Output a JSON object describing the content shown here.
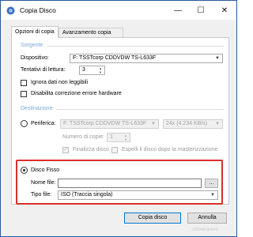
{
  "window": {
    "title": "Copia Disco",
    "minimize_glyph": "—",
    "maximize_glyph": "☐",
    "close_glyph": "✕"
  },
  "tabs": [
    {
      "label": "Opzioni di copia"
    },
    {
      "label": "Avanzamento copia"
    }
  ],
  "source": {
    "group_title": "Sorgente",
    "device_label": "Dispositivo:",
    "device_value": "F: TSSTcorp CDDVDW TS-L633F",
    "attempts_label": "Tentativi di lettura:",
    "attempts_value": "3",
    "ignore_bad_label": "Ignora dati non leggibili",
    "disable_hw_label": "Disabilita correzione errore hardware"
  },
  "destination": {
    "group_title": "Destinazione",
    "device_label": "Periferica:",
    "device_value": "F: TSSTcorp CDDVDW TS-L633F",
    "speed_value": "24x (4,234 KB/s)",
    "copies_label": "Numero di copie:",
    "copies_value": "1",
    "finalize_label": "Finalizza disco",
    "eject_label": "Espelli il disco dopo la masterizzazione"
  },
  "hard_disk": {
    "label": "Disco Fisso",
    "filename_label": "Nome file:",
    "filename_value": "",
    "browse_label": "...",
    "filetype_label": "Tipo file:",
    "filetype_value": "ISO (Traccia singola)"
  },
  "actions": {
    "copy_label": "Copia disco",
    "cancel_label": "Annulla"
  },
  "watermark": "chimerarevo",
  "colors": {
    "accent_border": "#0078d7",
    "highlight": "#d9302c",
    "group_title": "#7aa7d8"
  }
}
